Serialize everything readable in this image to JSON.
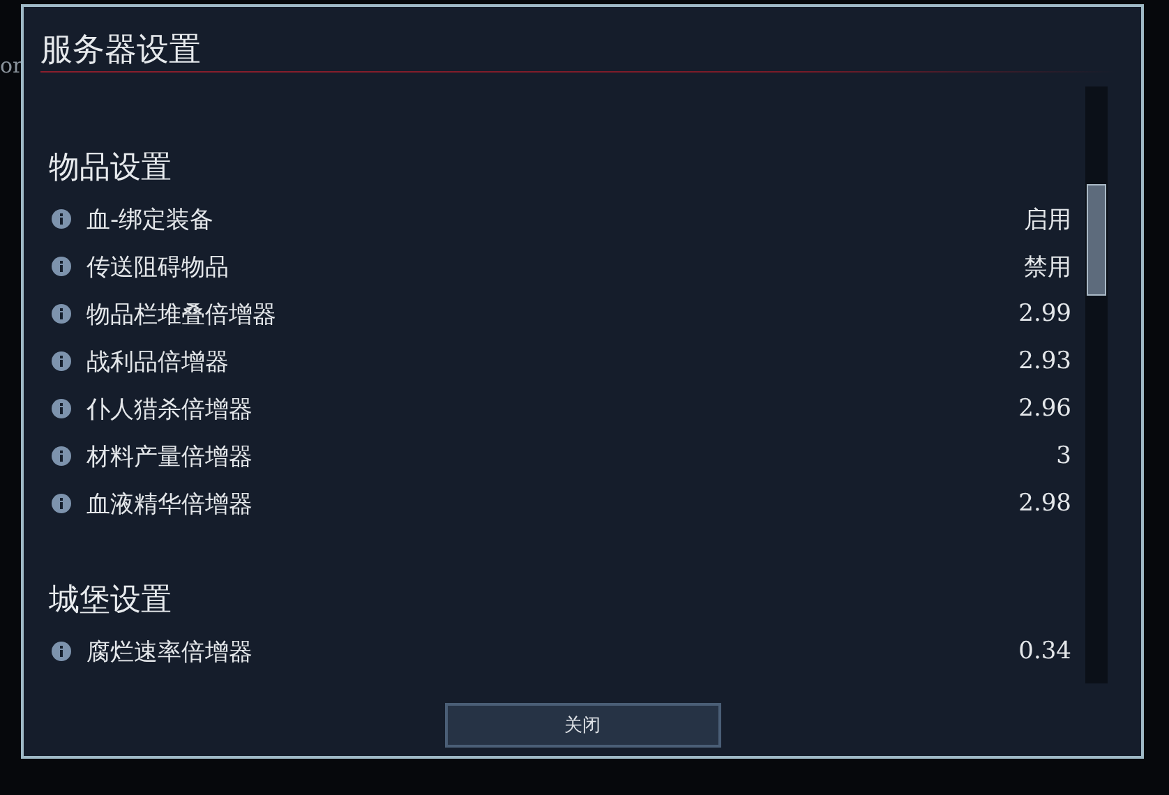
{
  "background": {
    "text": "or"
  },
  "window": {
    "title": "服务器设置"
  },
  "sections": [
    {
      "title": "物品设置",
      "rows": [
        {
          "label": "血-绑定装备",
          "value": "启用"
        },
        {
          "label": "传送阻碍物品",
          "value": "禁用"
        },
        {
          "label": "物品栏堆叠倍增器",
          "value": "2.99"
        },
        {
          "label": "战利品倍增器",
          "value": "2.93"
        },
        {
          "label": "仆人猎杀倍增器",
          "value": "2.96"
        },
        {
          "label": "材料产量倍增器",
          "value": "3"
        },
        {
          "label": "血液精华倍增器",
          "value": "2.98"
        }
      ]
    },
    {
      "title": "城堡设置",
      "rows": [
        {
          "label": "腐烂速率倍增器",
          "value": "0.34"
        }
      ]
    }
  ],
  "buttons": [
    "关闭"
  ]
}
